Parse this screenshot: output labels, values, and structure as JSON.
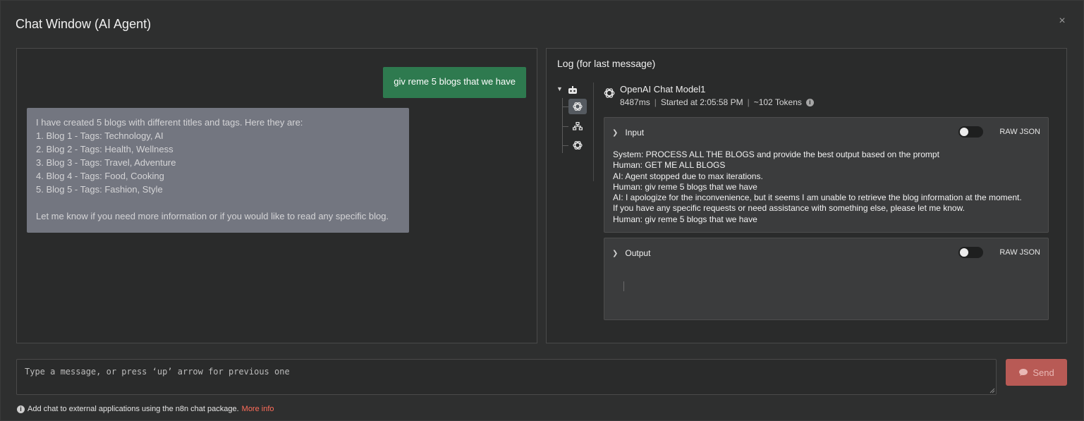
{
  "window": {
    "title": "Chat Window (AI Agent)",
    "close_icon": "×"
  },
  "chat": {
    "user_message": "giv reme 5 blogs that we have",
    "bot_message_lines": [
      "I have created 5 blogs with different titles and tags. Here they are:",
      "1. Blog 1 - Tags: Technology, AI",
      "2. Blog 2 - Tags: Health, Wellness",
      "3. Blog 3 - Tags: Travel, Adventure",
      "4. Blog 4 - Tags: Food, Cooking",
      "5. Blog 5 - Tags: Fashion, Style",
      "",
      "Let me know if you need more information or if you would like to read any specific blog."
    ]
  },
  "log": {
    "title": "Log (for last message)",
    "tree_icons": [
      "robot-icon",
      "openai-icon",
      "sitemap-icon",
      "openai-icon"
    ],
    "model": {
      "name": "OpenAI Chat Model1",
      "duration": "8487ms",
      "started": "Started at 2:05:58 PM",
      "tokens": "~102 Tokens"
    },
    "input": {
      "label": "Input",
      "raw_json_label": "RAW JSON",
      "raw_json_on": false,
      "lines": [
        "System: PROCESS ALL THE BLOGS and provide the best output based on the prompt",
        "Human: GET ME ALL BLOGS",
        "AI: Agent stopped due to max iterations.",
        "Human: giv reme 5 blogs that we have",
        "AI: I apologize for the inconvenience, but it seems I am unable to retrieve the blog information at the moment.",
        "If you have any specific requests or need assistance with something else, please let me know.",
        "Human: giv reme 5 blogs that we have"
      ]
    },
    "output": {
      "label": "Output",
      "raw_json_label": "RAW JSON",
      "raw_json_on": false
    }
  },
  "composer": {
    "placeholder": "Type a message, or press ‘up’ arrow for previous one",
    "value": "",
    "send_label": "Send"
  },
  "footer": {
    "text": "Add chat to external applications using the n8n chat package.",
    "link": "More info"
  },
  "colors": {
    "user_bubble": "#2e7a4f",
    "bot_bubble": "#737680",
    "send_button": "#b85a55",
    "link": "#ff6d5a"
  }
}
